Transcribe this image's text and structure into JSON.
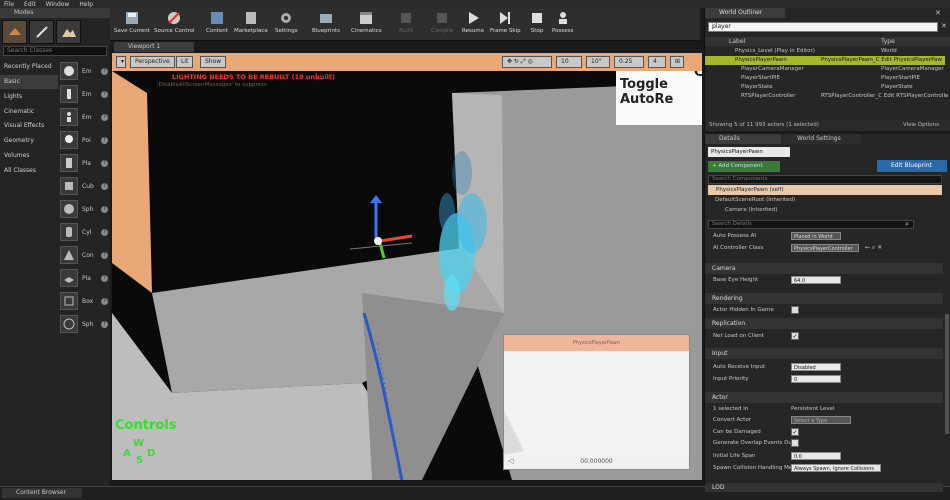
{
  "menu": [
    "File",
    "Edit",
    "Window",
    "Help"
  ],
  "modes": {
    "tab_label": "Modes",
    "search_placeholder": "Search Classes",
    "categories": [
      "Recently Placed",
      "Basic",
      "Lights",
      "Cinematic",
      "Visual Effects",
      "Geometry",
      "Volumes",
      "All Classes"
    ],
    "selected_category": "Basic",
    "items": [
      "Em",
      "Em",
      "Em",
      "Poi",
      "Pla",
      "Cub",
      "Sph",
      "Cyl",
      "Con",
      "Pla",
      "Box",
      "Sph"
    ]
  },
  "toolbar": {
    "buttons": [
      "Save Current",
      "Source Control",
      "Content",
      "Marketplace",
      "Settings",
      "Blueprints",
      "Cinematics",
      "Build",
      "Compile",
      "Resume",
      "Frame Skip",
      "Stop",
      "Possess"
    ]
  },
  "viewport": {
    "tab_label": "Viewport 1",
    "perspective": "Perspective",
    "lit": "Lit",
    "show": "Show",
    "grid_snap": "10",
    "rot_snap": "10°",
    "scale_snap": "0.25",
    "cam_speed": "4",
    "warning": "LIGHTING NEEDS TO BE REBUILT (10 unbuilt)",
    "warning_sub": "'DisableAllScreenMessages' to suppress",
    "toggle_text": "Toggle AutoRe",
    "toggle_prefix": "C",
    "controls_label": "Controls",
    "wasd": [
      "W",
      "A",
      "S",
      "D"
    ],
    "pip_title": "PhysicsPlayerPawn",
    "pip_value": "00.000000"
  },
  "bottom": {
    "content_browser": "Content Browser"
  },
  "outliner": {
    "tab_label": "World Outliner",
    "search_value": "player",
    "col_label": "Label",
    "col_type": "Type",
    "rows": [
      {
        "label": "Physics_Level (Play in Editor)",
        "type": "World"
      },
      {
        "label": "PhysicsPlayerPawn",
        "type": "PhysicsPlayerPawn_C  Edit PhysicsPlayerPaw"
      },
      {
        "label": "PlayerCameraManager",
        "type": "PlayerCameraManager"
      },
      {
        "label": "PlayerStartPIE",
        "type": "PlayerStartPIE"
      },
      {
        "label": "PlayerState",
        "type": "PlayerState"
      },
      {
        "label": "RTSPlayerController",
        "type": "RTSPlayerController_C  Edit RTSPlayerControlle"
      }
    ],
    "footer": "Showing 5 of 11 993 actors (1 selected)",
    "view_options": "View Options"
  },
  "details": {
    "tab_details": "Details",
    "tab_world": "World Settings",
    "object_name": "PhysicsPlayerPawn",
    "add_component": "+ Add Component",
    "edit_blueprint": "Edit Blueprint",
    "search_components": "Search Components",
    "self_label": "PhysicsPlayerPawn (self)",
    "default_root": "DefaultSceneRoot (Inherited)",
    "camera": "Camera (Inherited)",
    "search_details": "Search Details",
    "auto_possess_label": "Auto Possess AI",
    "auto_possess_value": "Placed in World",
    "ai_controller_label": "AI Controller Class",
    "ai_controller_value": "PhysicsPlayerController",
    "sections": {
      "camera": "Camera",
      "rendering": "Rendering",
      "replication": "Replication",
      "input": "Input",
      "actor": "Actor",
      "lod": "LOD"
    },
    "base_eye_label": "Base Eye Height",
    "base_eye_value": "64.0",
    "actor_hidden_label": "Actor Hidden In Game",
    "net_load_label": "Net Load on Client",
    "auto_receive_label": "Auto Receive Input",
    "auto_receive_value": "Disabled",
    "input_priority_label": "Input Priority",
    "input_priority_value": "0",
    "selected_label": "1 selected in",
    "persistent_level": "Persistent Level",
    "convert_actor_label": "Convert Actor",
    "convert_actor_value": "Select a Type",
    "can_be_damaged_label": "Can be Damaged",
    "gen_overlap_label": "Generate Overlap Events Duri",
    "initial_life_label": "Initial Life Span",
    "initial_life_value": "0.0",
    "spawn_coll_label": "Spawn Collision Handling Meth",
    "spawn_coll_value": "Always Spawn, Ignore Collisions"
  }
}
